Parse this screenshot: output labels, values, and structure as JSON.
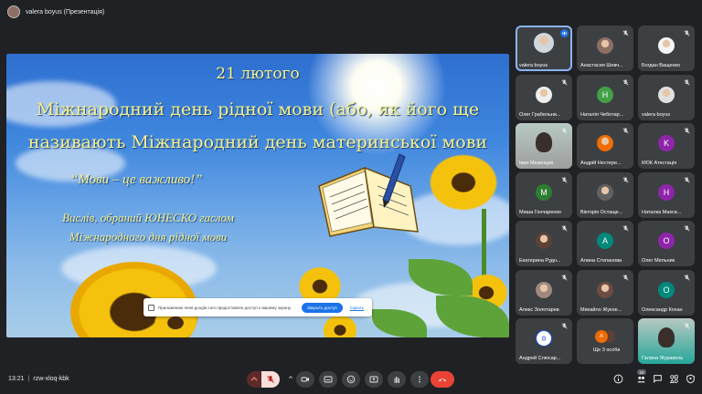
{
  "presenter": {
    "title": "valera boyus (Презентація)"
  },
  "slide": {
    "date": "21 лютого",
    "line1": "Міжнародний день рідної мови (або, як його ще",
    "line2": "називають Міжнародний день материнської мови",
    "quote": "“Мови – це важливо!”",
    "motto1": "Вислів, обраний ЮНЕСКО гаслом",
    "motto2": "Міжнародного дня рідної мови"
  },
  "toast": {
    "text": "Приложению meet.google.com предоставлен доступ к вашему экрану.",
    "share_button": "Закрыть доступ",
    "cancel": "Скрыть"
  },
  "participants": [
    {
      "name": "valera boyus",
      "avatar": "photo",
      "color": "#cfd8dc",
      "mic": "speaking"
    },
    {
      "name": "Анастасия Шевч...",
      "avatar": "photo",
      "color": "#8d6e63",
      "mic": "muted"
    },
    {
      "name": "Богдан Ващенко",
      "avatar": "photo",
      "color": "#f5f5f5",
      "mic": "muted"
    },
    {
      "name": "Олег Грабельни...",
      "avatar": "photo",
      "color": "#eeeeee",
      "mic": "muted"
    },
    {
      "name": "Наталія Чеботар...",
      "avatar": "H",
      "color": "#43a047",
      "mic": "muted"
    },
    {
      "name": "valera boyus",
      "avatar": "photo",
      "color": "#e0e0e0",
      "mic": "muted"
    },
    {
      "name": "Іван Мезенцев",
      "avatar": "video",
      "color": "#9e9e9e",
      "mic": "muted"
    },
    {
      "name": "Андрій Нестере...",
      "avatar": "photo",
      "color": "#ef6c00",
      "mic": "muted"
    },
    {
      "name": "КЮК Атестація",
      "avatar": "K",
      "color": "#8e24aa",
      "mic": "muted"
    },
    {
      "name": "Миша Гончаренко",
      "avatar": "M",
      "color": "#2e7d32",
      "mic": "muted"
    },
    {
      "name": "Вікторія Остаще...",
      "avatar": "photo",
      "color": "#616161",
      "mic": "muted"
    },
    {
      "name": "Наталка Макси...",
      "avatar": "H",
      "color": "#8e24aa",
      "mic": "muted"
    },
    {
      "name": "Екатерина Рудн...",
      "avatar": "photo",
      "color": "#5d4037",
      "mic": "muted"
    },
    {
      "name": "Алина Степанова",
      "avatar": "A",
      "color": "#00897b",
      "mic": "muted"
    },
    {
      "name": "Олег Мельник",
      "avatar": "O",
      "color": "#8e24aa",
      "mic": "muted"
    },
    {
      "name": "Алекс Золотарев",
      "avatar": "photo",
      "color": "#a1887f",
      "mic": "muted"
    },
    {
      "name": "Михайло Жукое...",
      "avatar": "photo",
      "color": "#6d4c41",
      "mic": "muted"
    },
    {
      "name": "Олександр Кохан",
      "avatar": "O",
      "color": "#00897b",
      "mic": "muted"
    },
    {
      "name": "Андрей Слюсар...",
      "avatar": "flag",
      "color": "#ffffff",
      "mic": "muted"
    },
    {
      "name": "Ще 3 особи",
      "avatar": "more",
      "color": "#ef6c00",
      "mic": "none"
    },
    {
      "name": "Галина Журавель",
      "avatar": "video",
      "color": "#26a69a",
      "mic": "muted"
    }
  ],
  "more_avatar_letter": "А",
  "flag_symbol": "✡",
  "bottom": {
    "time": "13:21",
    "meeting_code": "rzw-xloq-kbk",
    "participant_count": "24"
  },
  "colors": {
    "background": "#202124",
    "tile": "#3c4043",
    "danger": "#ea4335",
    "slide_text": "#f5f28c"
  }
}
